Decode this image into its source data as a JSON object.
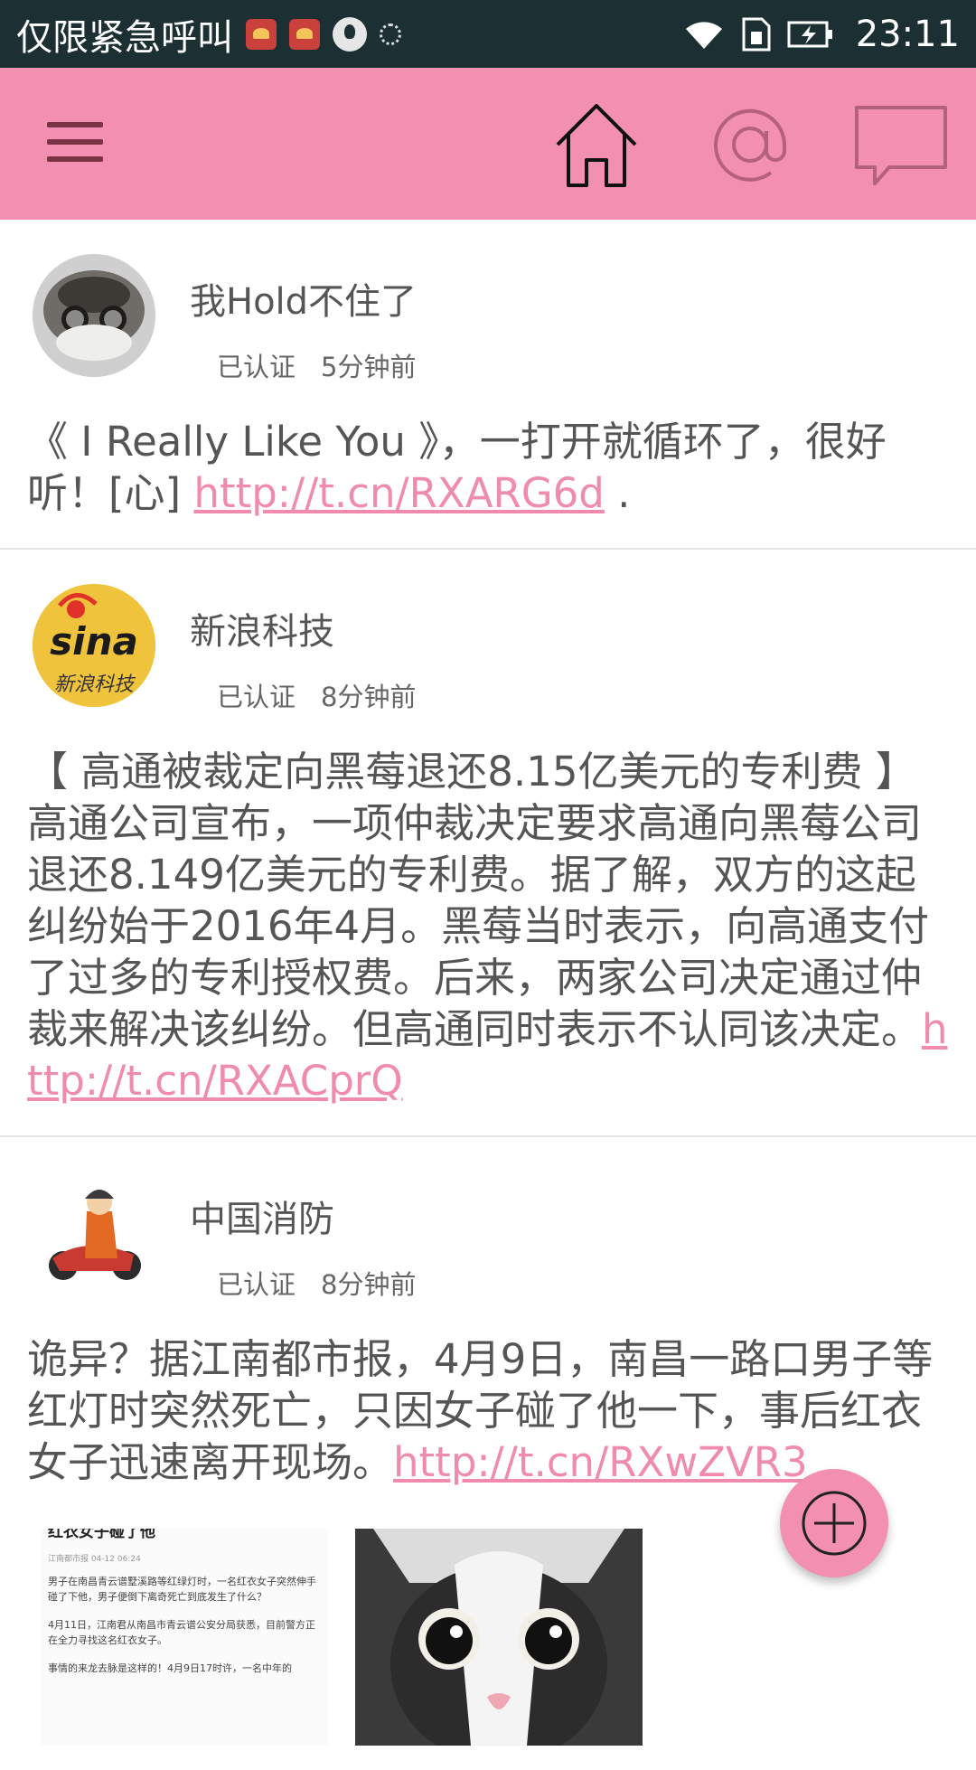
{
  "status_bar": {
    "carrier": "仅限紧急呼叫",
    "time": "23:11",
    "icons": [
      "huawei-app-icon",
      "huawei-app-icon",
      "qq-icon",
      "loading-icon",
      "wifi-icon",
      "sim-icon",
      "battery-charging-icon"
    ]
  },
  "app_bar": {
    "menu_icon": "hamburger-menu-icon",
    "tabs": [
      {
        "icon": "home-icon",
        "selected": true
      },
      {
        "icon": "at-mention-icon",
        "selected": false
      },
      {
        "icon": "comment-icon",
        "selected": false
      }
    ],
    "colors": {
      "bar": "#f38fb0",
      "selected": "#111111",
      "unselected": "#b4617c"
    }
  },
  "posts": [
    {
      "author": "我Hold不住了",
      "verified": "已认证",
      "time": "5分钟前",
      "text": "《 I Really Like You 》，一打开就循环了，很好听！[心] ",
      "link": "http://t.cn/RXARG6d",
      "suffix": " ."
    },
    {
      "author": "新浪科技",
      "verified": "已认证",
      "time": "8分钟前",
      "text": "【 高通被裁定向黑莓退还8.15亿美元的专利费 】高通公司宣布，一项仲裁决定要求高通向黑莓公司退还8.149亿美元的专利费。据了解，双方的这起纠纷始于2016年4月。黑莓当时表示，向高通支付了过多的专利授权费。后来，两家公司决定通过仲裁来解决该纠纷。但高通同时表示不认同该决定。",
      "link": "http://t.cn/RXACprQ",
      "avatar_text": [
        "sina",
        "新浪科技"
      ]
    },
    {
      "author": "中国消防",
      "verified": "已认证",
      "time": "8分钟前",
      "text": "诡异？据江南都市报，4月9日，南昌一路口男子等红灯时突然死亡，只因女子碰了他一下，事后红衣女子迅速离开现场。",
      "link": "http://t.cn/RXwZVR3",
      "article_thumb": {
        "title": "红衣女子碰了他",
        "source": "江南都市报 04-12 06:24",
        "para1": "男子在南昌青云谱墅溪路等红绿灯时，一名红衣女子突然伸手碰了下他，男子便倒下离奇死亡到底发生了什么？",
        "para2": "4月11日，江南君从南昌市青云谱公安分局获悉，目前警方正在全力寻找这名红衣女子。",
        "para3": "事情的来龙去脉是这样的！4月9日17时许，一名中年的"
      }
    }
  ],
  "fab": {
    "icon": "add-circle-icon"
  }
}
